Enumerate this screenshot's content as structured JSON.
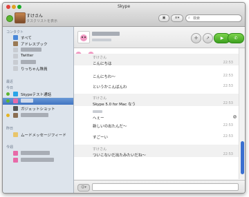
{
  "window": {
    "title": "Skype"
  },
  "me": {
    "name": "すけさん",
    "mood": "タスクリストを表示"
  },
  "toolbar": {
    "search_placeholder": "検索"
  },
  "sidebar": {
    "contacts_header": "コンタクト",
    "contacts": [
      {
        "label": "すべて"
      },
      {
        "label": "アドレスブック"
      },
      {
        "label": ""
      },
      {
        "label": "Twitter"
      },
      {
        "label": ""
      },
      {
        "label": "りっちゃん隊員"
      }
    ],
    "recent_header": "最近",
    "today_header": "今日",
    "today": [
      {
        "label": "Skypeテスト通話"
      },
      {
        "label": ""
      },
      {
        "label": "ガジェットショット"
      },
      {
        "label": ""
      }
    ],
    "yesterday_header": "昨日",
    "yesterday": [
      {
        "label": "ムードメッセージフィード"
      }
    ],
    "lastweek_header": "今週",
    "lastweek": [
      {
        "label": ""
      },
      {
        "label": ""
      }
    ]
  },
  "chat": {
    "messages": [
      {
        "sender": "すけさん",
        "text": "こんにちは",
        "time": "22:53"
      },
      {
        "sender": "",
        "text": "こんにちわ〜",
        "time": "22:53"
      },
      {
        "sender": "",
        "text": "というかこんばんわ",
        "time": "22:53"
      },
      {
        "sender": "すけさん",
        "text": "Skype 5.0 for Mac なう",
        "time": "22:53"
      },
      {
        "sender": "",
        "text": "へぇー",
        "time": "22:53"
      },
      {
        "sender": "",
        "text": "新しいの出たんだ〜",
        "time": "22:53"
      },
      {
        "sender": "",
        "text": "すごーい",
        "time": "22:53"
      },
      {
        "sender": "すけさん",
        "text": "ついこないだ出たみたいだね〜",
        "time": "22:53"
      }
    ]
  },
  "colors": {
    "accent": "#3f73c2",
    "call_green": "#3ea020",
    "status_online": "#5cb531"
  }
}
